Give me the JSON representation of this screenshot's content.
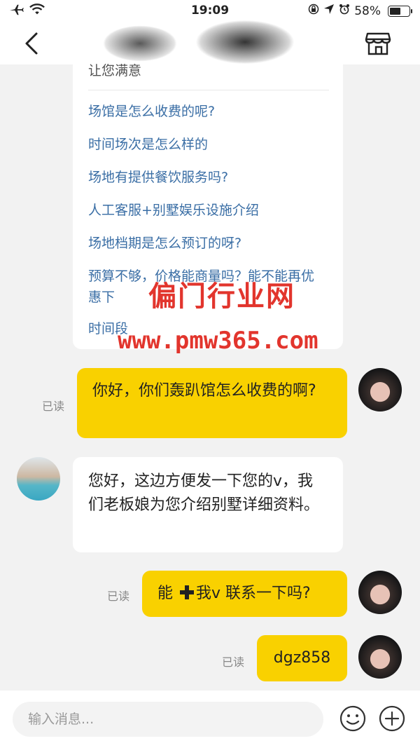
{
  "status_bar": {
    "time": "19:09",
    "battery": "58%",
    "icons": [
      "airplane-icon",
      "wifi-icon",
      "lock-rotation-icon",
      "location-icon",
      "alarm-icon",
      "battery-icon"
    ]
  },
  "nav": {
    "back_icon": "chevron-left-icon",
    "store_icon": "store-icon"
  },
  "faq": {
    "partial_heading": "让您满意",
    "items": [
      "场馆是怎么收费的呢?",
      "时间场次是怎么样的",
      "场地有提供餐饮服务吗?",
      "人工客服+别墅娱乐设施介绍",
      "场地档期是怎么预订的呀?",
      "预算不够，价格能商量吗？能不能再优惠下",
      "时间段"
    ]
  },
  "watermark": {
    "line1": "偏门行业网",
    "line2": "www.pmw365.com"
  },
  "messages": [
    {
      "from": "me",
      "text": "你好，你们轰趴馆怎么收费的啊?",
      "status": "已读"
    },
    {
      "from": "them",
      "text": "您好，这边方便发一下您的v，我们老板娘为您介绍别墅详细资料。"
    },
    {
      "from": "me",
      "text_before": "能",
      "icon": "plus-icon",
      "text_after": "我v 联系一下吗?",
      "status": "已读"
    },
    {
      "from": "me",
      "text": "dgz858",
      "status": "已读"
    }
  ],
  "input_bar": {
    "placeholder": "输入消息...",
    "emoji_icon": "emoji-icon",
    "add_icon": "plus-circle-icon"
  },
  "colors": {
    "my_bubble": "#f9d100",
    "link": "#3a6ea5",
    "watermark": "#e0241c",
    "background": "#f2f2f2"
  }
}
